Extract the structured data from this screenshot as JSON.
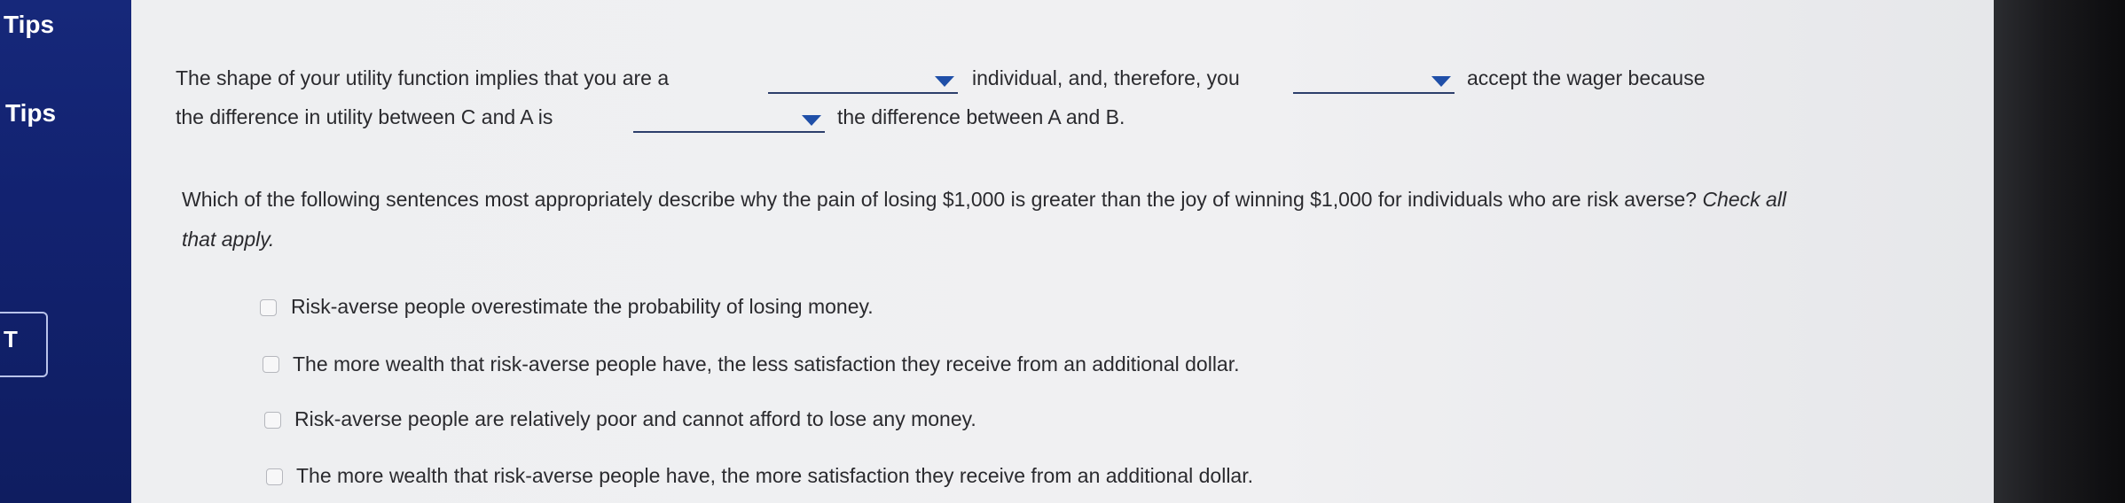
{
  "sidebar": {
    "tips_label_1": "Tips",
    "tips_label_2": "Tips",
    "t_button": "T"
  },
  "fill_in": {
    "line1_part1": "The shape of your utility function implies that you are a",
    "line1_part2": "individual, and, therefore, you",
    "line1_part3": "accept the wager because",
    "line2_part1": "the difference in utility between C and A is",
    "line2_part2": "the difference between A and B."
  },
  "question": {
    "text": "Which of the following sentences most appropriately describe why the pain of losing $1,000 is greater than the joy of winning $1,000 for individuals who are risk averse?",
    "instruction": "Check all that apply."
  },
  "options": [
    {
      "label": "Risk-averse people overestimate the probability of losing money.",
      "checked": false
    },
    {
      "label": "The more wealth that risk-averse people have, the less satisfaction they receive from an additional dollar.",
      "checked": false
    },
    {
      "label": "Risk-averse people are relatively poor and cannot afford to lose any money.",
      "checked": false
    },
    {
      "label": "The more wealth that risk-averse people have, the more satisfaction they receive from an additional dollar.",
      "checked": false
    }
  ],
  "colors": {
    "sidebar": "#16287a",
    "panel": "#f0f0f2",
    "dropdown_caret": "#1f4fa8"
  }
}
